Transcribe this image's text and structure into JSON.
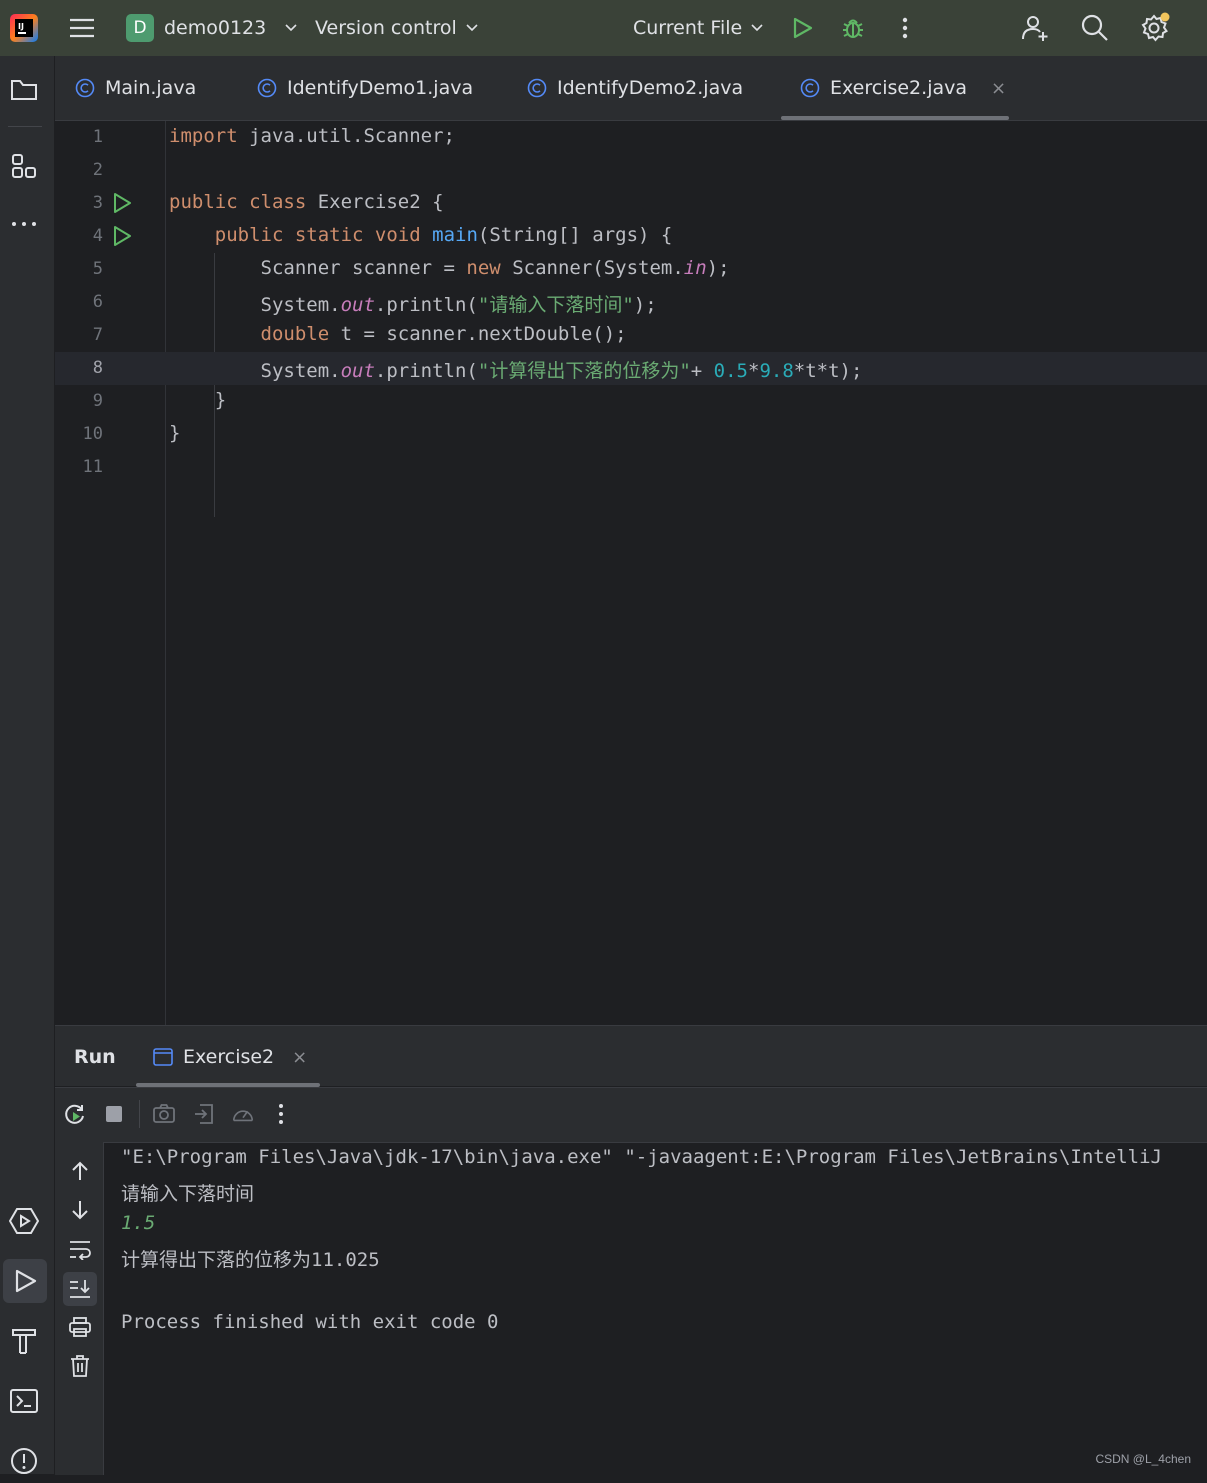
{
  "titlebar": {
    "project_initial": "D",
    "project_name": "demo0123",
    "vcs_label": "Version control",
    "run_config": "Current File"
  },
  "tabs": [
    {
      "label": "Main.java",
      "active": false
    },
    {
      "label": "IdentifyDemo1.java",
      "active": false
    },
    {
      "label": "IdentifyDemo2.java",
      "active": false
    },
    {
      "label": "Exercise2.java",
      "active": true
    }
  ],
  "tab_close_glyph": "×",
  "editor": {
    "current_line": 8,
    "line_numbers": [
      "1",
      "2",
      "3",
      "4",
      "5",
      "6",
      "7",
      "8",
      "9",
      "10",
      "11"
    ],
    "code": {
      "l1_kw": "import",
      "l1_rest": " java.util.Scanner;",
      "l3_kw": "public class",
      "l3_rest": " Exercise2 {",
      "l4_kw": "public static void",
      "l4_fn": "main",
      "l4_rest": "(String[] args) {",
      "l5_a": "Scanner scanner = ",
      "l5_kw": "new",
      "l5_b": " Scanner(System.",
      "l5_fld": "in",
      "l5_c": ");",
      "l6_a": "System.",
      "l6_fld": "out",
      "l6_b": ".println(",
      "l6_str": "\"请输入下落时间\"",
      "l6_c": ");",
      "l7_kw": "double",
      "l7_rest": " t = scanner.nextDouble();",
      "l8_a": "System.",
      "l8_fld": "out",
      "l8_b": ".println(",
      "l8_str": "\"计算得出下落的位移为\"",
      "l8_c": "+ ",
      "l8_n1": "0.5",
      "l8_op": "*",
      "l8_n2": "9.8",
      "l8_d": "*t*t);",
      "l9": "}",
      "l10": "}"
    }
  },
  "run_panel": {
    "title": "Run",
    "tab_label": "Exercise2",
    "console": [
      "\"E:\\Program Files\\Java\\jdk-17\\bin\\java.exe\" \"-javaagent:E:\\Program Files\\JetBrains\\IntelliJ",
      "请输入下落时间",
      "1.5",
      "计算得出下落的位移为11.025",
      "",
      "Process finished with exit code 0"
    ]
  },
  "watermark": "CSDN @L_4chen",
  "colors": {
    "titlebar_bg": "#3a4238",
    "run_green": "#5fb865",
    "keyword": "#cf8e6d",
    "string": "#6aab73",
    "number": "#2aacb8",
    "field": "#c77dbb",
    "function": "#56a8f5"
  },
  "icons": [
    "intellij-logo-icon",
    "hamburger-menu-icon",
    "chevron-down-icon",
    "run-icon",
    "debug-icon",
    "more-vertical-icon",
    "add-user-icon",
    "search-icon",
    "settings-icon",
    "project-folder-icon",
    "structure-icon",
    "more-horizontal-icon",
    "services-icon",
    "run-tool-icon",
    "build-icon",
    "terminal-icon",
    "problems-icon",
    "class-icon",
    "rerun-icon",
    "stop-icon",
    "screenshot-icon",
    "restore-layout-icon",
    "profiler-icon",
    "arrow-up-icon",
    "arrow-down-icon",
    "soft-wrap-icon",
    "scroll-to-end-icon",
    "print-icon",
    "trash-icon"
  ]
}
